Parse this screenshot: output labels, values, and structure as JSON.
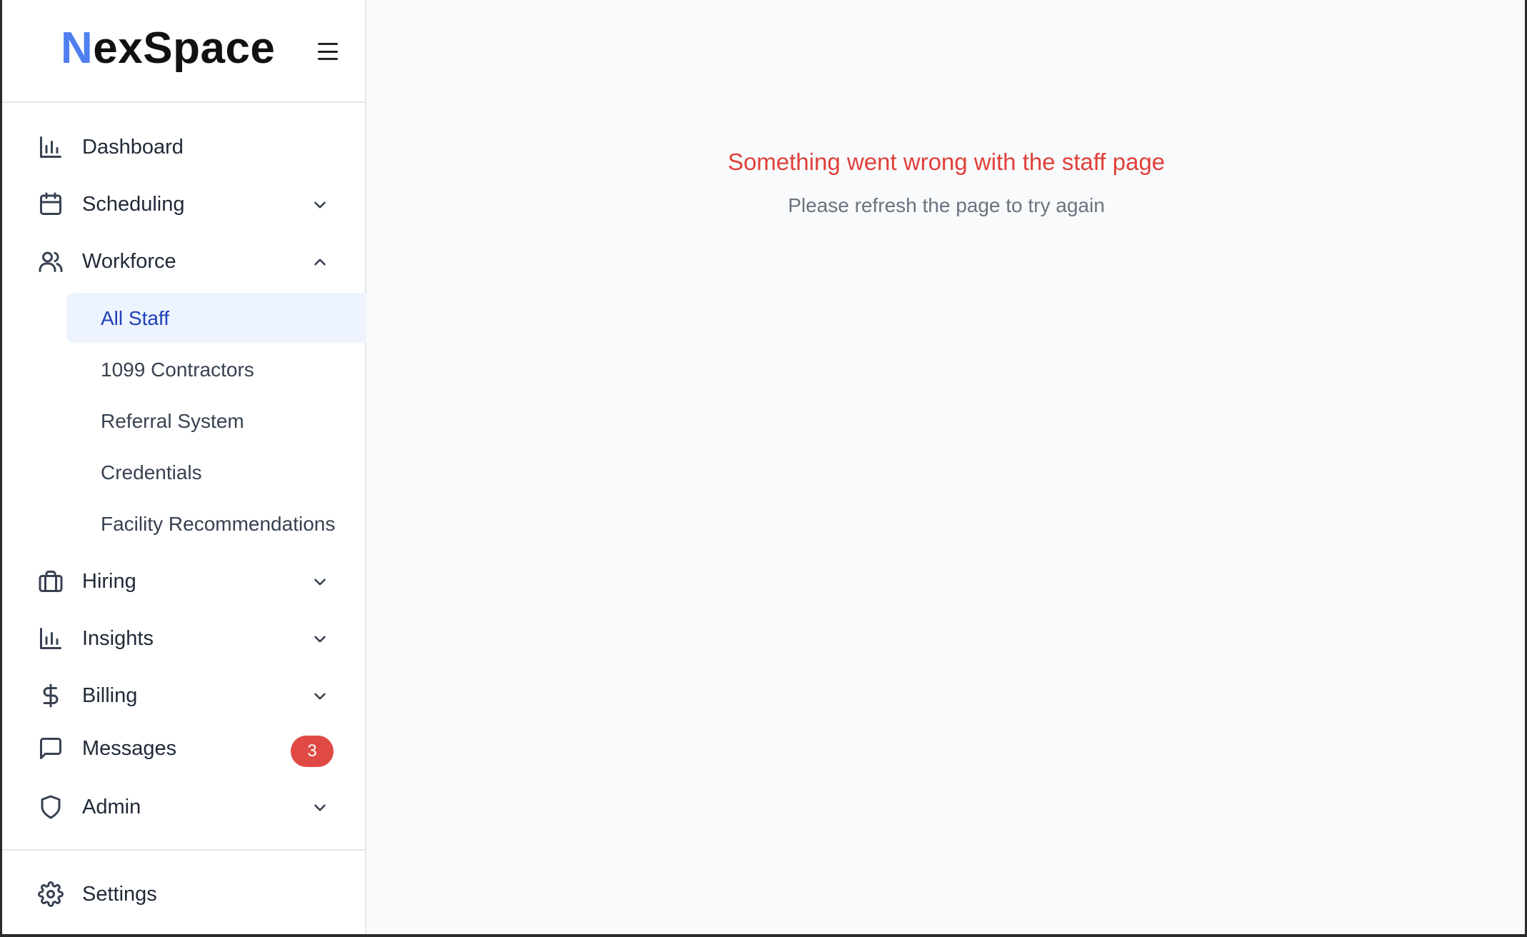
{
  "brand": {
    "logo_first": "N",
    "logo_rest": "exSpace"
  },
  "nav": {
    "dashboard": "Dashboard",
    "scheduling": "Scheduling",
    "workforce": "Workforce",
    "hiring": "Hiring",
    "insights": "Insights",
    "billing": "Billing",
    "messages": "Messages",
    "messages_badge": "3",
    "admin": "Admin",
    "settings": "Settings"
  },
  "workforce_sub": {
    "all_staff": "All Staff",
    "contractors": "1099 Contractors",
    "referral": "Referral System",
    "credentials": "Credentials",
    "facility_recs": "Facility Recommendations"
  },
  "error": {
    "title": "Something went wrong with the staff page",
    "subtitle": "Please refresh the page to try again"
  },
  "colors": {
    "accent": "#4f7ff0",
    "active_bg": "#eef4ff",
    "active_text": "#1e3fb8",
    "error": "#e0403a",
    "badge": "#e04a45"
  }
}
